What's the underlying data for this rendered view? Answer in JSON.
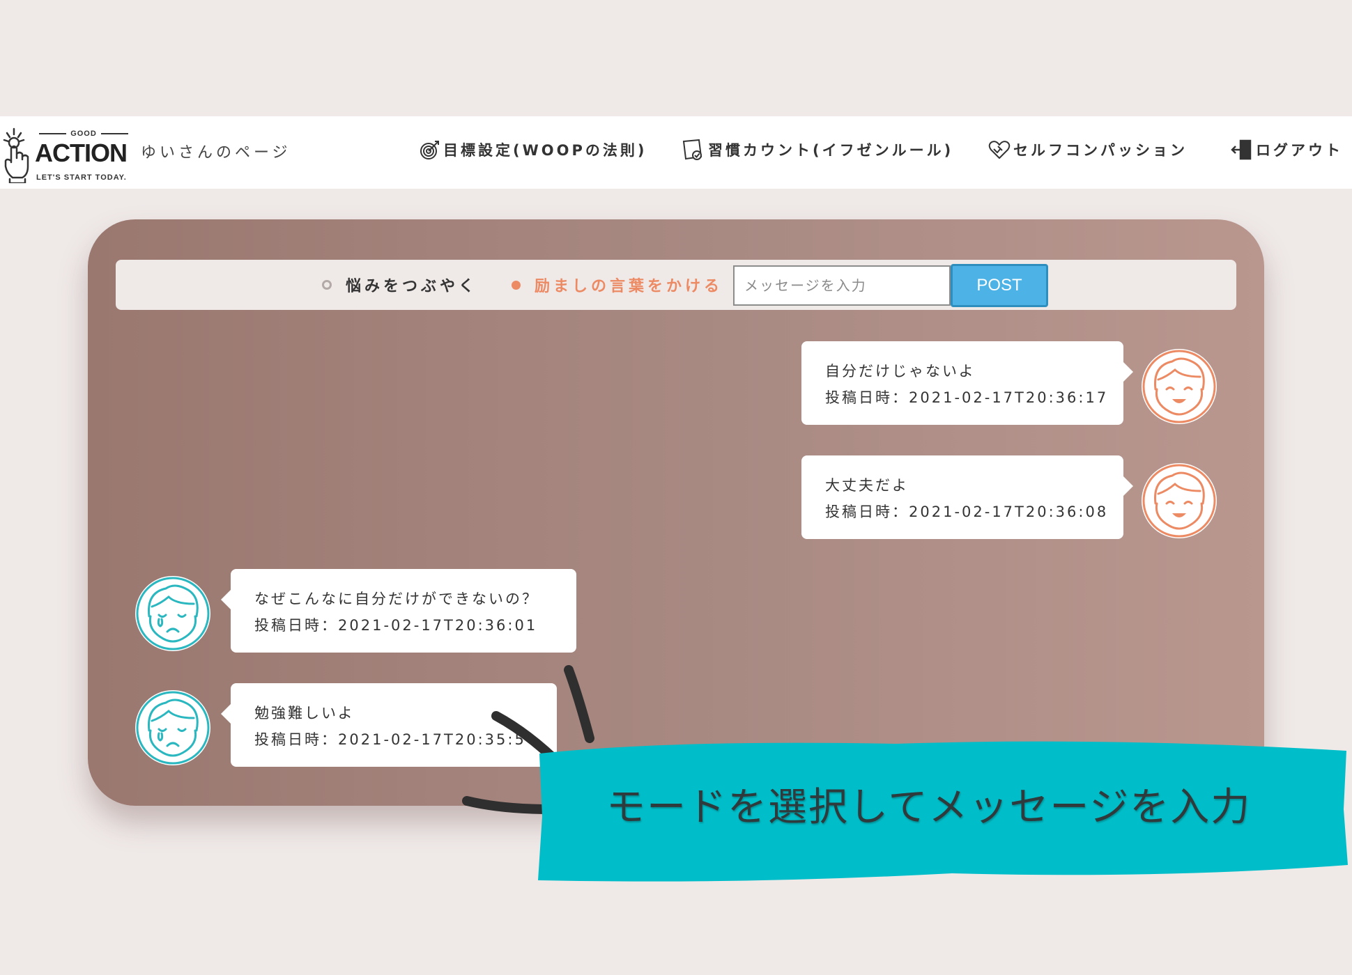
{
  "header": {
    "logo": {
      "top_text": "GOOD",
      "main_text": "ACTION",
      "tagline": "LET'S START TODAY."
    },
    "user_page": "ゆいさんのページ",
    "nav": {
      "woop": "目標設定(WOOPの法則)",
      "habit": "習慣カウント(イフゼンルール)",
      "self_compassion": "セルフコンパッション",
      "logout": "ログアウト"
    }
  },
  "mode_bar": {
    "vent_label": "悩みをつぶやく",
    "cheer_label": "励ましの言葉をかける",
    "selected": "cheer",
    "input_placeholder": "メッセージを入力",
    "input_value": "",
    "post_label": "POST"
  },
  "messages": [
    {
      "side": "right",
      "mood": "happy",
      "text": "自分だけじゃないよ",
      "posted_label": "投稿日時：",
      "posted_at": "2021-02-17T20:36:17"
    },
    {
      "side": "right",
      "mood": "happy",
      "text": "大丈夫だよ",
      "posted_label": "投稿日時：",
      "posted_at": "2021-02-17T20:36:08"
    },
    {
      "side": "left",
      "mood": "crying",
      "text": "なぜこんなに自分だけができないの？",
      "posted_label": "投稿日時：",
      "posted_at": "2021-02-17T20:36:01"
    },
    {
      "side": "left",
      "mood": "crying",
      "text": "勉強難しいよ",
      "posted_label": "投稿日時：",
      "posted_at": "2021-02-17T20:35:5"
    }
  ],
  "annotation": {
    "text": "モードを選択してメッセージを入力"
  },
  "colors": {
    "background": "#efe9e8",
    "card_gradient_start": "#9a7870",
    "card_gradient_end": "#b9978f",
    "accent_orange": "#ec8a64",
    "accent_teal": "#2ab7bf",
    "post_button": "#4db3e6",
    "callout": "#00bec9"
  }
}
